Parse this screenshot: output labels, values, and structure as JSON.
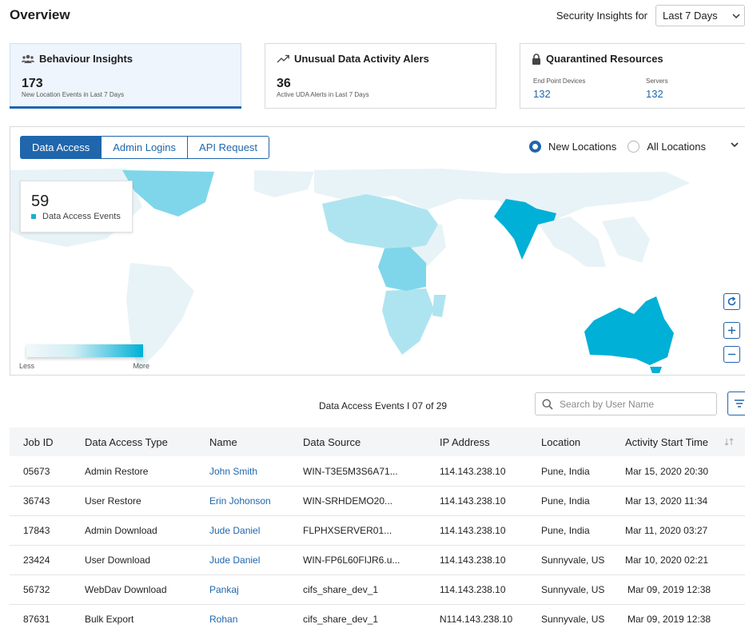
{
  "page_title": "Overview",
  "range": {
    "label": "Security Insights for",
    "selected": "Last 7 Days"
  },
  "cards": {
    "behaviour": {
      "title": "Behaviour Insights",
      "number": "173",
      "subtitle": "New Location Events in Last 7 Days"
    },
    "uda": {
      "title": "Unusual Data Activity Alers",
      "number": "36",
      "subtitle": "Active UDA Alerts in Last 7 Days"
    },
    "quarantine": {
      "title": "Quarantined Resources",
      "endpoint_label": "End Point Devices",
      "endpoint_value": "132",
      "servers_label": "Servers",
      "servers_value": "132"
    }
  },
  "map": {
    "tabs": [
      "Data Access",
      "Admin Logins",
      "API Request"
    ],
    "radios": [
      "New Locations",
      "All Locations"
    ],
    "stat_number": "59",
    "stat_label": "Data Access Events",
    "legend_less": "Less",
    "legend_more": "More",
    "colors": {
      "dark": "#00b0d6",
      "mid": "#7fd6ea",
      "light": "#aee4f0",
      "pale": "#e4f2f6"
    }
  },
  "table": {
    "caption": "Data Access Events I 07 of  29",
    "search_placeholder": "Search by User Name",
    "headers": [
      "Job ID",
      "Data Access Type",
      "Name",
      "Data Source",
      "IP Address",
      "Location",
      "Activity Start Time"
    ],
    "rows": [
      [
        "05673",
        "Admin Restore",
        "John Smith",
        "WIN-T3E5M3S6A71...",
        "114.143.238.10",
        "Pune, India",
        "Mar 15, 2020 20:30"
      ],
      [
        "36743",
        "User Restore",
        "Erin Johonson",
        "WIN-SRHDEMO20...",
        "114.143.238.10",
        "Pune, India",
        "Mar 13, 2020 11:34"
      ],
      [
        "17843",
        "Admin Download",
        "Jude Daniel",
        "FLPHXSERVER01...",
        "114.143.238.10",
        "Pune, India",
        "Mar 11, 2020 03:27"
      ],
      [
        "23424",
        "User Download",
        "Jude Daniel",
        "WIN-FP6L60FIJR6.u...",
        "114.143.238.10",
        "Sunnyvale, US",
        "Mar 10, 2020 02:21"
      ],
      [
        "56732",
        "WebDav Download",
        "Pankaj",
        "cifs_share_dev_1",
        "114.143.238.10",
        "Sunnyvale, US",
        "Mar 09, 2019 12:38"
      ],
      [
        "87631",
        "Bulk Export",
        "Rohan",
        "cifs_share_dev_1",
        "N114.143.238.10",
        "Sunnyvale, US",
        "Mar 09, 2019 12:38"
      ]
    ]
  }
}
